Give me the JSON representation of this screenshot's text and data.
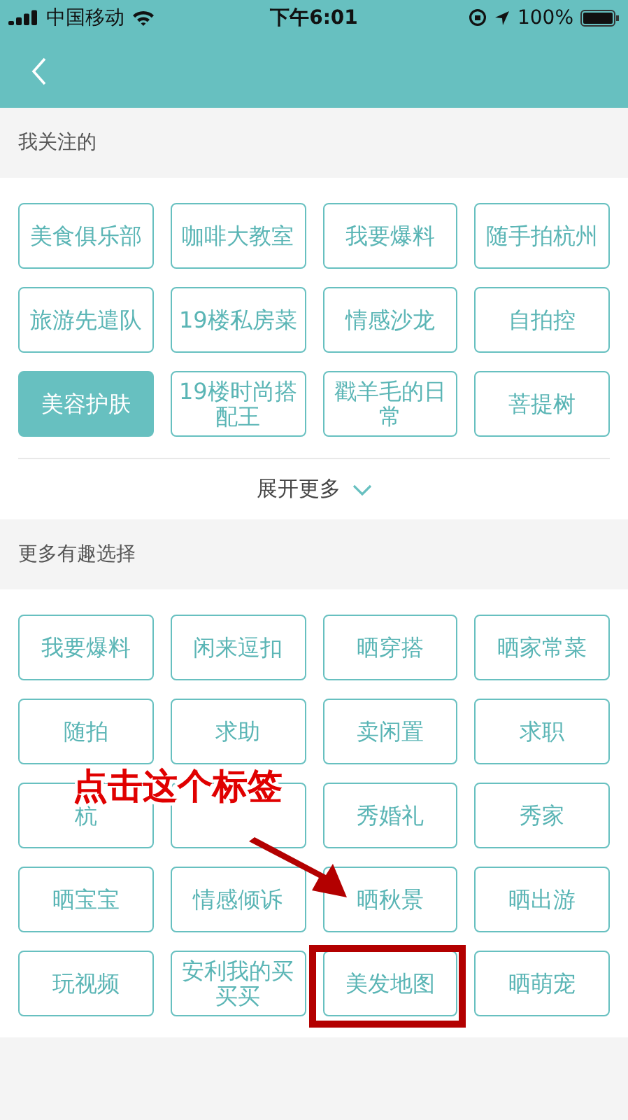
{
  "status_bar": {
    "carrier": "中国移动",
    "time": "下午6:01",
    "battery": "100%"
  },
  "followed": {
    "title": "我关注的",
    "tags": [
      {
        "label": "美食俱乐部",
        "selected": false
      },
      {
        "label": "咖啡大教室",
        "selected": false
      },
      {
        "label": "我要爆料",
        "selected": false
      },
      {
        "label": "随手拍杭州",
        "selected": false
      },
      {
        "label": "旅游先遣队",
        "selected": false
      },
      {
        "label": "19楼私房菜",
        "selected": false
      },
      {
        "label": "情感沙龙",
        "selected": false
      },
      {
        "label": "自拍控",
        "selected": false
      },
      {
        "label": "美容护肤",
        "selected": true
      },
      {
        "label": "19楼时尚搭配王",
        "selected": false
      },
      {
        "label": "戳羊毛的日常",
        "selected": false
      },
      {
        "label": "菩提树",
        "selected": false
      }
    ],
    "expand": "展开更多"
  },
  "more": {
    "title": "更多有趣选择",
    "tags": [
      {
        "label": "我要爆料",
        "selected": false,
        "highlighted": false
      },
      {
        "label": "闲来逗扣",
        "selected": false,
        "highlighted": false
      },
      {
        "label": "晒穿搭",
        "selected": false,
        "highlighted": false
      },
      {
        "label": "晒家常菜",
        "selected": false,
        "highlighted": false
      },
      {
        "label": "随拍",
        "selected": false,
        "highlighted": false
      },
      {
        "label": "求助",
        "selected": false,
        "highlighted": false
      },
      {
        "label": "卖闲置",
        "selected": false,
        "highlighted": false
      },
      {
        "label": "求职",
        "selected": false,
        "highlighted": false
      },
      {
        "label": "杭",
        "selected": false,
        "highlighted": false
      },
      {
        "selected": false,
        "highlighted": false
      },
      {
        "label": "秀婚礼",
        "selected": false,
        "highlighted": false
      },
      {
        "label": "秀家",
        "selected": false,
        "highlighted": false
      },
      {
        "label": "晒宝宝",
        "selected": false,
        "highlighted": false
      },
      {
        "label": "情感倾诉",
        "selected": false,
        "highlighted": false
      },
      {
        "label": "晒秋景",
        "selected": false,
        "highlighted": false
      },
      {
        "label": "晒出游",
        "selected": false,
        "highlighted": false
      },
      {
        "label": "玩视频",
        "selected": false,
        "highlighted": false
      },
      {
        "label": "安利我的买买买",
        "selected": false,
        "highlighted": false
      },
      {
        "label": "美发地图",
        "selected": false,
        "highlighted": true
      },
      {
        "label": "晒萌宠",
        "selected": false,
        "highlighted": false
      }
    ]
  },
  "annotation": {
    "text": "点击这个标签"
  }
}
